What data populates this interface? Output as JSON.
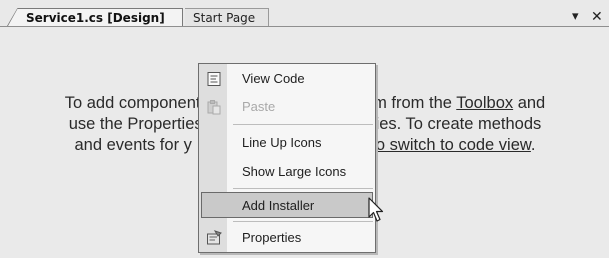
{
  "tabs": {
    "active_label": "Service1.cs [Design]",
    "inactive_label": "Start Page",
    "dropdown_icon": "chevron-down-icon",
    "close_icon": "close-icon"
  },
  "designer": {
    "line1_prefix": "To add components",
    "line1_hidden_suffix": "hem from the ",
    "toolbox_link": "Toolbox",
    "line1_end": " and",
    "line2_prefix": "use the Properties w",
    "line2_suffix": "perties. To create methods",
    "line3_prefix": "and events for y",
    "code_view_link": "o switch to code view",
    "line3_end": "."
  },
  "context_menu": {
    "items": [
      {
        "label": "View Code",
        "icon": "view-code-icon",
        "enabled": true
      },
      {
        "label": "Paste",
        "icon": "paste-icon",
        "enabled": false
      },
      {
        "label": "Line Up Icons",
        "enabled": true
      },
      {
        "label": "Show Large Icons",
        "enabled": true
      },
      {
        "label": "Add Installer",
        "enabled": true,
        "highlighted": true
      },
      {
        "label": "Properties",
        "icon": "properties-icon",
        "enabled": true
      }
    ]
  }
}
